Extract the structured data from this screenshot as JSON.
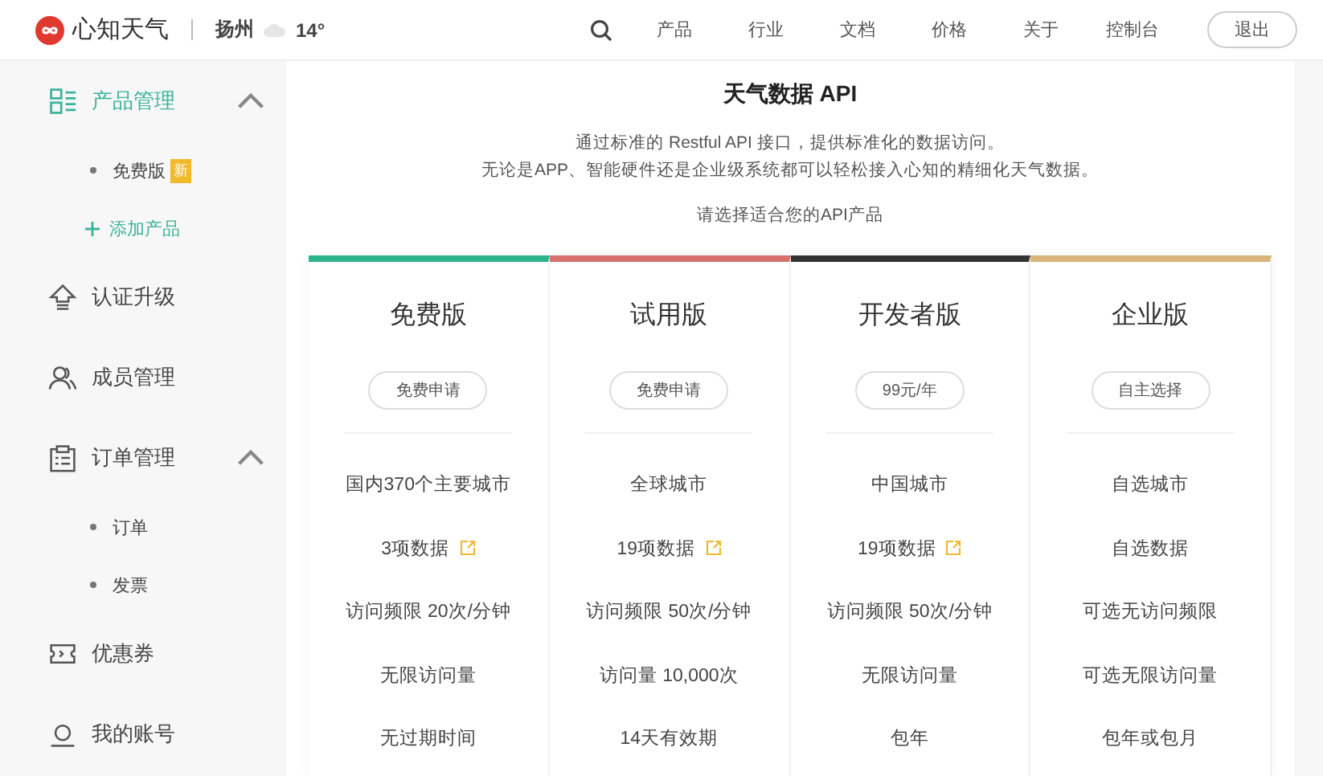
{
  "header": {
    "brand": "心知天气",
    "city": "扬州",
    "temperature": "14°",
    "nav": [
      {
        "label": "产品"
      },
      {
        "label": "行业"
      },
      {
        "label": "文档"
      },
      {
        "label": "价格"
      },
      {
        "label": "关于"
      },
      {
        "label": "控制台"
      }
    ],
    "button": "退出"
  },
  "sidebar": {
    "items": [
      {
        "kind": "group",
        "label": "产品管理",
        "selected": true,
        "expanded": true,
        "children": [
          {
            "kind": "sub",
            "label": "免费版",
            "badge": "新"
          },
          {
            "kind": "add",
            "label": "添加产品"
          }
        ]
      },
      {
        "kind": "group",
        "label": "认证升级",
        "selected": false
      },
      {
        "kind": "group",
        "label": "成员管理",
        "selected": false
      },
      {
        "kind": "group",
        "label": "订单管理",
        "selected": false,
        "expanded": true,
        "children": [
          {
            "kind": "sub",
            "label": "订单"
          },
          {
            "kind": "sub",
            "label": "发票"
          }
        ]
      },
      {
        "kind": "group",
        "label": "优惠券",
        "selected": false
      },
      {
        "kind": "group",
        "label": "我的账号",
        "selected": false
      }
    ]
  },
  "main": {
    "title": "天气数据 API",
    "description": [
      "通过标准的 Restful API 接口，提供标准化的数据访问。",
      "无论是APP、智能硬件还是企业级系统都可以轻松接入心知的精细化天气数据。"
    ],
    "prompt": "请选择适合您的API产品",
    "plans": [
      {
        "name": "免费版",
        "color": "#2bb38a",
        "button": "免费申请",
        "features": [
          {
            "text": "国内370个主要城市",
            "link": false
          },
          {
            "text": "3项数据",
            "link": true
          },
          {
            "text": "访问频限 20次/分钟",
            "link": false
          },
          {
            "text": "无限访问量",
            "link": false
          },
          {
            "text": "无过期时间",
            "link": false
          }
        ]
      },
      {
        "name": "试用版",
        "color": "#d97070",
        "button": "免费申请",
        "features": [
          {
            "text": "全球城市",
            "link": false
          },
          {
            "text": "19项数据",
            "link": true
          },
          {
            "text": "访问频限 50次/分钟",
            "link": false
          },
          {
            "text": "访问量 10,000次",
            "link": false
          },
          {
            "text": "14天有效期",
            "link": false
          }
        ]
      },
      {
        "name": "开发者版",
        "color": "#333333",
        "button": "99元/年",
        "features": [
          {
            "text": "中国城市",
            "link": false
          },
          {
            "text": "19项数据",
            "link": true
          },
          {
            "text": "访问频限 50次/分钟",
            "link": false
          },
          {
            "text": "无限访问量",
            "link": false
          },
          {
            "text": "包年",
            "link": false
          }
        ]
      },
      {
        "name": "企业版",
        "color": "#d9b57a",
        "button": "自主选择",
        "features": [
          {
            "text": "自选城市",
            "link": false
          },
          {
            "text": "自选数据",
            "link": false
          },
          {
            "text": "可选无访问频限",
            "link": false
          },
          {
            "text": "可选无限访问量",
            "link": false
          },
          {
            "text": "包年或包月",
            "link": false
          }
        ]
      }
    ]
  }
}
